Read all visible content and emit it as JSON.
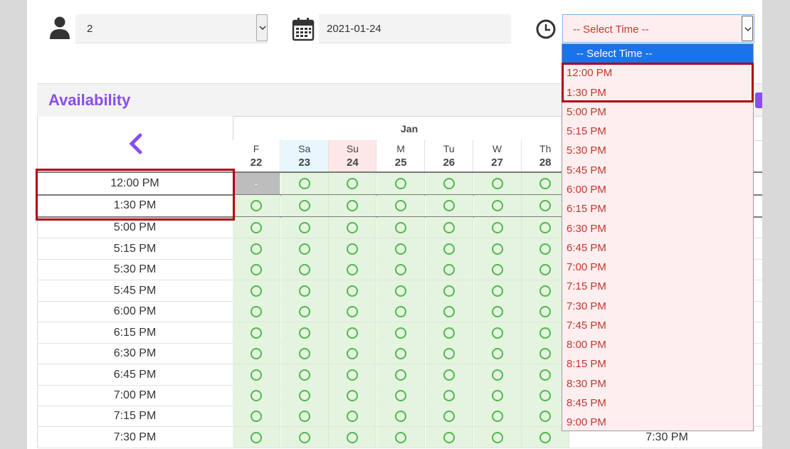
{
  "controls": {
    "people_value": "2",
    "date_value": "2021-01-24",
    "time_placeholder": "-- Select Time --"
  },
  "availability": {
    "title": "Availability",
    "month": "Jan",
    "days": [
      {
        "abbr": "F",
        "num": "22"
      },
      {
        "abbr": "Sa",
        "num": "23"
      },
      {
        "abbr": "Su",
        "num": "24"
      },
      {
        "abbr": "M",
        "num": "25"
      },
      {
        "abbr": "Tu",
        "num": "26"
      },
      {
        "abbr": "W",
        "num": "27"
      },
      {
        "abbr": "Th",
        "num": "28"
      }
    ],
    "times": [
      "12:00 PM",
      "1:30 PM",
      "5:00 PM",
      "5:15 PM",
      "5:30 PM",
      "5:45 PM",
      "6:00 PM",
      "6:15 PM",
      "6:30 PM",
      "6:45 PM",
      "7:00 PM",
      "7:15 PM",
      "7:30 PM"
    ],
    "unavailable_symbol": "-",
    "right_time_label": "7:30 PM"
  },
  "dropdown": {
    "options": [
      "-- Select Time --",
      "12:00 PM",
      "1:30 PM",
      "5:00 PM",
      "5:15 PM",
      "5:30 PM",
      "5:45 PM",
      "6:00 PM",
      "6:15 PM",
      "6:30 PM",
      "6:45 PM",
      "7:00 PM",
      "7:15 PM",
      "7:30 PM",
      "7:45 PM",
      "8:00 PM",
      "8:15 PM",
      "8:30 PM",
      "8:45 PM",
      "9:00 PM"
    ]
  },
  "colors": {
    "accent": "#8a4df0",
    "available": "#52b74e",
    "available_bg": "#e4f4df",
    "highlight": "#b00012",
    "dropdown_text": "#c0392b",
    "dropdown_selected": "#1a73e8"
  },
  "icons": [
    "person-icon",
    "calendar-icon",
    "clock-icon",
    "chevron-left-icon",
    "chevron-down-icon"
  ]
}
